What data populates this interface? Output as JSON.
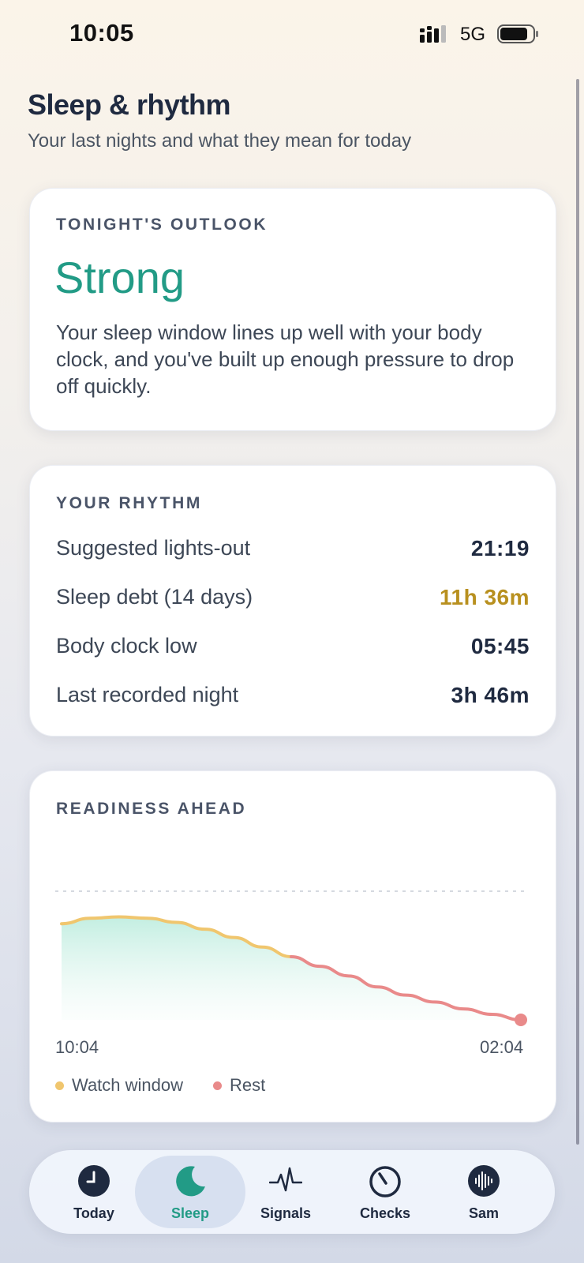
{
  "status": {
    "time": "10:05",
    "network": "5G"
  },
  "header": {
    "title": "Sleep & rhythm",
    "subtitle": "Your last nights and what they mean for today"
  },
  "outlook": {
    "label": "TONIGHT'S OUTLOOK",
    "value": "Strong",
    "description": "Your sleep window lines up well with your body clock, and you've built up enough pressure to drop off quickly."
  },
  "rhythm": {
    "label": "YOUR RHYTHM",
    "rows": [
      {
        "label": "Suggested lights-out",
        "value": "21:19"
      },
      {
        "label": "Sleep debt (14 days)",
        "value": "11h 36m"
      },
      {
        "label": "Body clock low",
        "value": "05:45"
      },
      {
        "label": "Last recorded night",
        "value": "3h 46m"
      }
    ]
  },
  "readiness": {
    "label": "READINESS AHEAD",
    "x_start": "10:04",
    "x_end": "02:04",
    "legend": [
      {
        "label": "Watch window",
        "color": "#f0c66e"
      },
      {
        "label": "Rest",
        "color": "#e98a8a"
      }
    ]
  },
  "chart_data": {
    "type": "area",
    "x": [
      "10:04",
      "11:04",
      "12:04",
      "13:04",
      "14:04",
      "15:04",
      "16:04",
      "17:04",
      "18:04",
      "19:04",
      "20:04",
      "21:04",
      "22:04",
      "23:04",
      "00:04",
      "01:04",
      "02:04"
    ],
    "series": [
      {
        "name": "Watch window",
        "values": [
          0.7,
          0.74,
          0.75,
          0.74,
          0.71,
          0.66,
          0.6,
          0.53,
          0.46,
          null,
          null,
          null,
          null,
          null,
          null,
          null,
          null
        ]
      },
      {
        "name": "Rest",
        "values": [
          null,
          null,
          null,
          null,
          null,
          null,
          null,
          null,
          0.46,
          0.39,
          0.32,
          0.24,
          0.18,
          0.13,
          0.08,
          0.04,
          0.0
        ]
      }
    ],
    "ylim": [
      0,
      1
    ],
    "grid": false
  },
  "tabs": [
    {
      "label": "Today",
      "icon": "clock-icon",
      "active": false
    },
    {
      "label": "Sleep",
      "icon": "moon-icon",
      "active": true
    },
    {
      "label": "Signals",
      "icon": "pulse-icon",
      "active": false
    },
    {
      "label": "Checks",
      "icon": "timer-icon",
      "active": false
    },
    {
      "label": "Sam",
      "icon": "voice-icon",
      "active": false
    }
  ],
  "colors": {
    "accent": "#229b86",
    "warning": "#b8901f",
    "watch": "#f0c66e",
    "rest": "#e98a8a"
  }
}
